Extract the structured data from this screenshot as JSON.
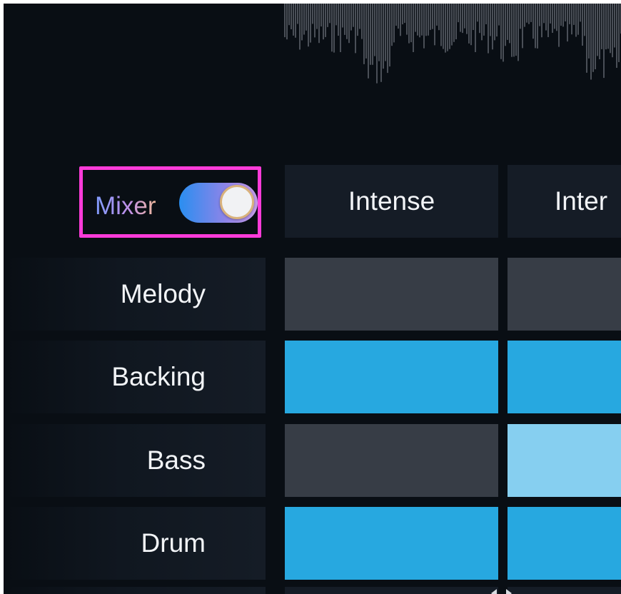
{
  "mixer": {
    "label": "Mixer",
    "toggle_on": true
  },
  "columns": [
    {
      "label": "Intense"
    },
    {
      "label": "Inter"
    }
  ],
  "rows": [
    {
      "label": "Melody",
      "cells": [
        "off",
        "off"
      ]
    },
    {
      "label": "Backing",
      "cells": [
        "on",
        "on"
      ]
    },
    {
      "label": "Bass",
      "cells": [
        "off",
        "partial"
      ]
    },
    {
      "label": "Drum",
      "cells": [
        "on",
        "on"
      ]
    }
  ],
  "colors": {
    "background": "#090e14",
    "header": "#151c26",
    "cell_off": "#373d46",
    "cell_on": "#27a8e0",
    "cell_partial": "#86cff0",
    "highlight": "#ff3bd9"
  },
  "icons": {
    "waveform": "waveform-icon",
    "scroll_left": "chevron-left-icon",
    "scroll_right": "chevron-right-icon"
  }
}
